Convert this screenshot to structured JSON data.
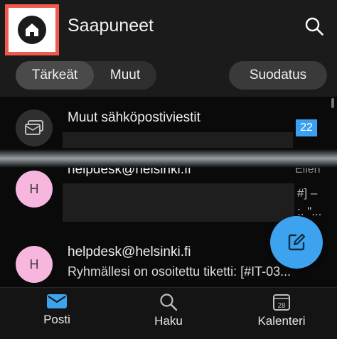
{
  "header": {
    "title": "Saapuneet"
  },
  "filters": {
    "important": "Tärkeät",
    "other": "Muut",
    "filter_button": "Suodatus"
  },
  "list": [
    {
      "type": "group",
      "title": "Muut sähköpostiviestit",
      "count": "22"
    },
    {
      "avatar": "H",
      "sender": "helpdesk@helsinki.fi",
      "time": "Eilen",
      "preview_fragments": [
        "#] –",
        ":. \"..."
      ]
    },
    {
      "avatar": "H",
      "sender": "helpdesk@helsinki.fi",
      "preview": "Ryhmällesi on osoitettu tiketti: [#IT-03..."
    }
  ],
  "nav": {
    "mail": "Posti",
    "search": "Haku",
    "calendar": "Kalenteri",
    "calendar_day": "28"
  },
  "colors": {
    "accent": "#3ea3ef",
    "highlight_border": "#ef5a4f",
    "avatar_pink": "#f6b6dd"
  }
}
